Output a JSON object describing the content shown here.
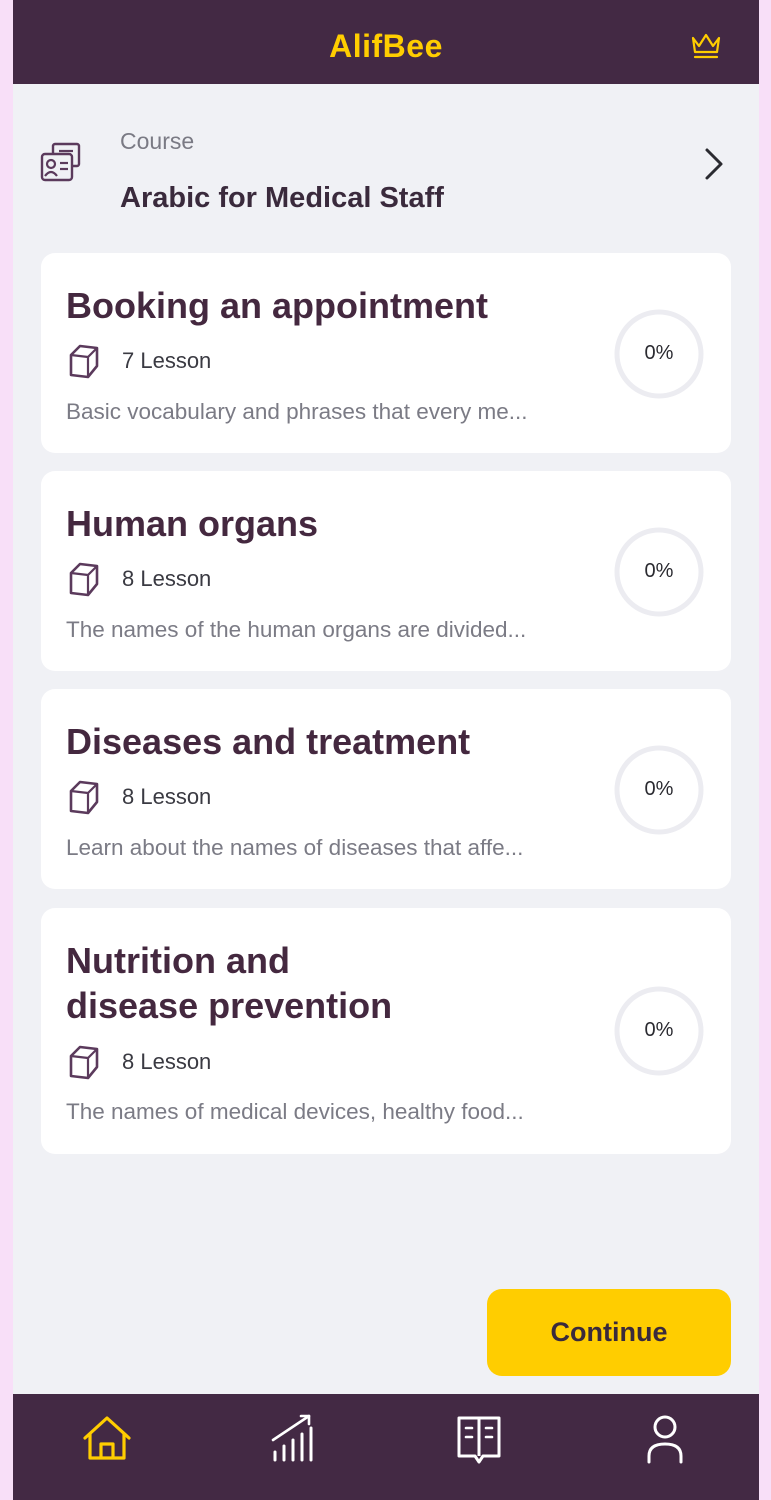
{
  "header": {
    "logo_text": "AlifBee",
    "crown_icon": "crown-icon",
    "accent_color": "#ffcd00",
    "bar_color": "#432944"
  },
  "course": {
    "kicker": "Course",
    "title": "Arabic for Medical Staff",
    "icon": "certificate-icon",
    "chevron": "chevron-right-icon"
  },
  "units": [
    {
      "title": "Booking an appointment",
      "lessons": "7 Lesson",
      "description": "Basic vocabulary and phrases that every me...",
      "progress_label": "0%",
      "progress": 0
    },
    {
      "title": "Human organs",
      "lessons": "8 Lesson",
      "description": "The names of the human organs are divided...",
      "progress_label": "0%",
      "progress": 0
    },
    {
      "title": "Diseases and treatment",
      "lessons": "8 Lesson",
      "description": "Learn about the names of diseases that affe...",
      "progress_label": "0%",
      "progress": 0
    },
    {
      "title": "Nutrition and disease prevention",
      "lessons": "8 Lesson",
      "description": "The names of medical devices, healthy food...",
      "progress_label": "0%",
      "progress": 0
    }
  ],
  "actions": {
    "continue_label": "Continue"
  },
  "nav": [
    {
      "icon": "home-icon",
      "active": true
    },
    {
      "icon": "stats-icon",
      "active": false
    },
    {
      "icon": "book-icon",
      "active": false
    },
    {
      "icon": "profile-icon",
      "active": false
    }
  ]
}
